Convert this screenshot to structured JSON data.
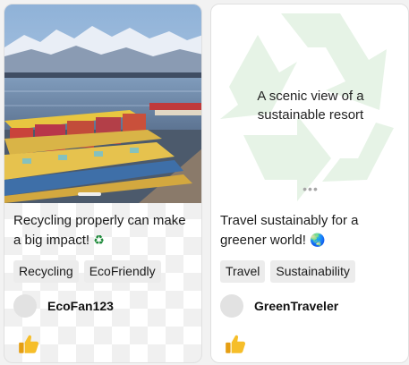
{
  "posts": [
    {
      "caption": "Recycling properly can make a big impact!",
      "emoji": "♻",
      "tags": [
        "Recycling",
        "EcoFriendly"
      ],
      "author": "EcoFan123",
      "media": {
        "type": "photo",
        "carousel_index": 1,
        "carousel_count": 1
      }
    },
    {
      "caption": "Travel sustainably for a greener world!",
      "emoji": "🌏",
      "tags": [
        "Travel",
        "Sustainability"
      ],
      "author": "GreenTraveler",
      "media": {
        "type": "placeholder",
        "alt_text": "A scenic view of a sustainable resort",
        "placeholder_icon": "recycle-icon",
        "more_indicator": "•••"
      }
    }
  ],
  "icons": {
    "like": "thumbs-up-icon",
    "avatar": "avatar-placeholder"
  },
  "colors": {
    "tag_bg": "#ececec",
    "placeholder_icon": "#e4f2e4",
    "like": "#f2b31b"
  }
}
